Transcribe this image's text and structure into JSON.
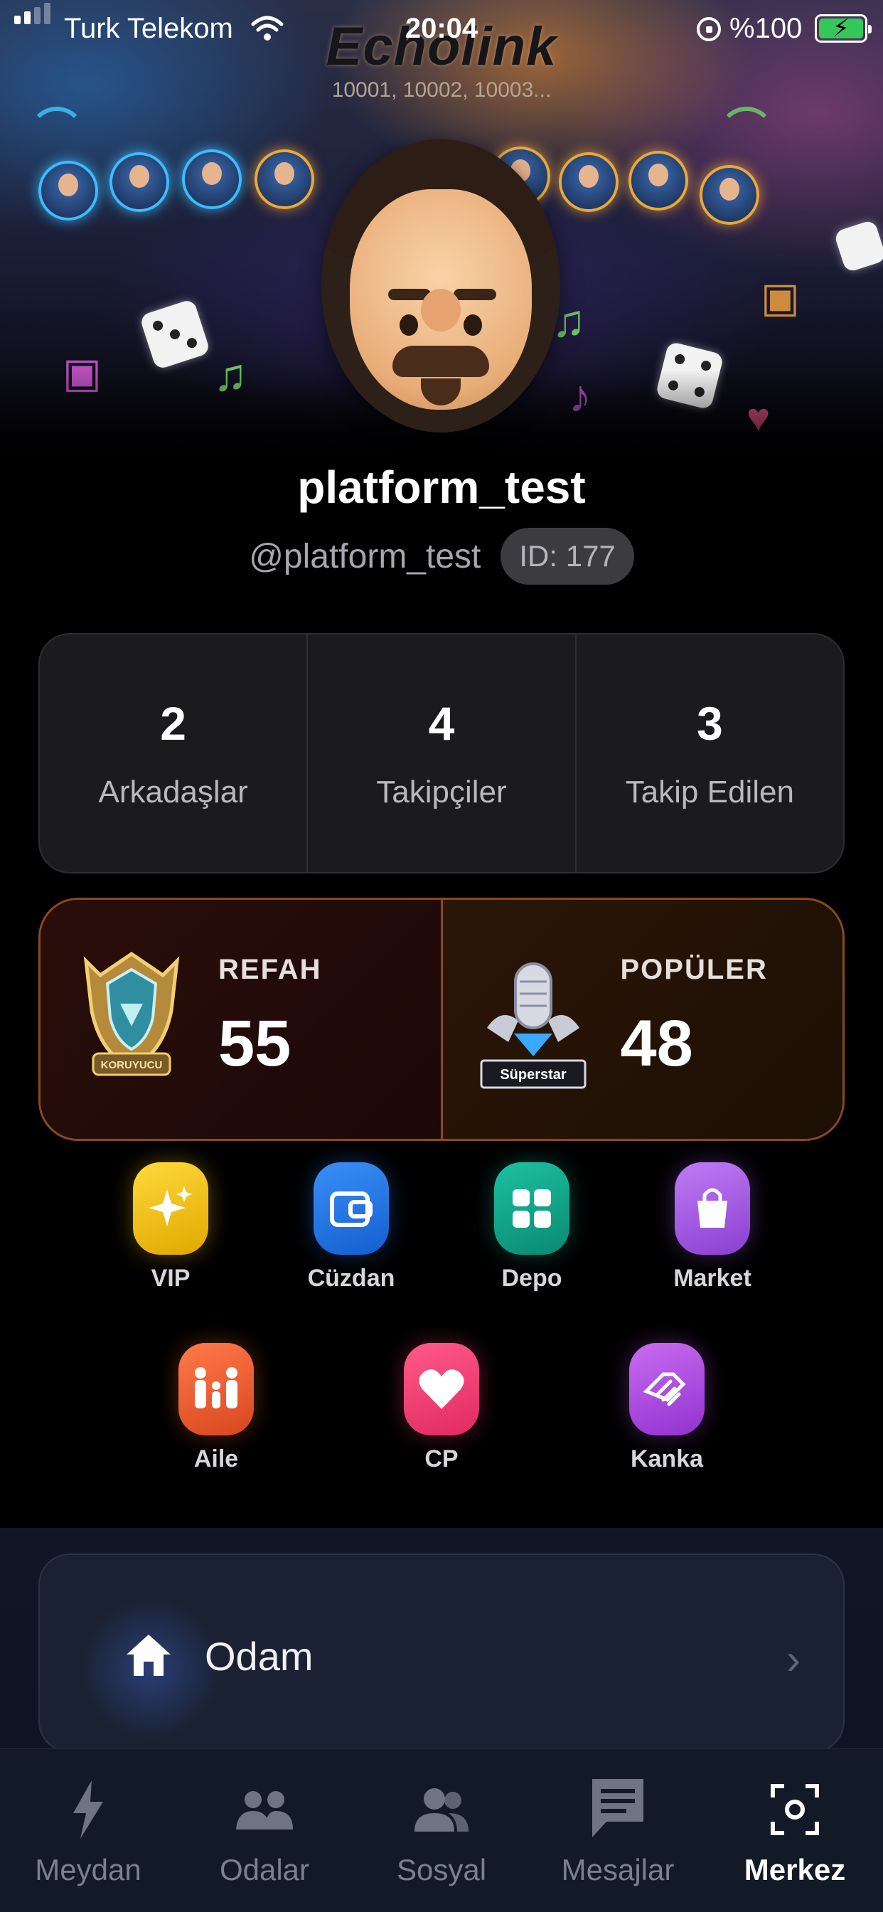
{
  "status_bar": {
    "carrier": "Turk Telekom",
    "time": "20:04",
    "battery": "%100"
  },
  "banner": {
    "logo": "Echolink",
    "subtitle": "10001, 10002, 10003..."
  },
  "profile": {
    "username": "platform_test",
    "handle": "@platform_test",
    "id_label": "ID: 177"
  },
  "stats": [
    {
      "value": "2",
      "label": "Arkadaşlar"
    },
    {
      "value": "4",
      "label": "Takipçiler"
    },
    {
      "value": "3",
      "label": "Takip Edilen"
    }
  ],
  "badges": {
    "wealth": {
      "title": "REFAH",
      "value": "55",
      "emblem_text": "KORUYUCU"
    },
    "popular": {
      "title": "POPÜLER",
      "value": "48",
      "emblem_text": "Süperstar"
    }
  },
  "features": [
    {
      "label": "VIP",
      "icon": "sparkle-icon",
      "color": "#f2c200"
    },
    {
      "label": "Cüzdan",
      "icon": "wallet-icon",
      "color": "#1f7ae8"
    },
    {
      "label": "Depo",
      "icon": "grid-icon",
      "color": "#0fa88b"
    },
    {
      "label": "Market",
      "icon": "shopping-bag-icon",
      "color": "#a35ae0"
    },
    {
      "label": "Aile",
      "icon": "family-icon",
      "color": "#f06038"
    },
    {
      "label": "CP",
      "icon": "heart-icon",
      "color": "#ee3a73"
    },
    {
      "label": "Kanka",
      "icon": "handshake-icon",
      "color": "#b04ce0"
    }
  ],
  "my_room": {
    "label": "Odam"
  },
  "tabs": [
    {
      "label": "Meydan",
      "icon": "lightning-icon"
    },
    {
      "label": "Odalar",
      "icon": "group-icon"
    },
    {
      "label": "Sosyal",
      "icon": "people-icon"
    },
    {
      "label": "Mesajlar",
      "icon": "message-icon"
    },
    {
      "label": "Merkez",
      "icon": "scan-focus-icon",
      "active": true
    }
  ],
  "colors": {
    "accent_active_tab": "#ffffff",
    "badge_border": "#8a4a1d",
    "battery_green": "#34c759"
  }
}
